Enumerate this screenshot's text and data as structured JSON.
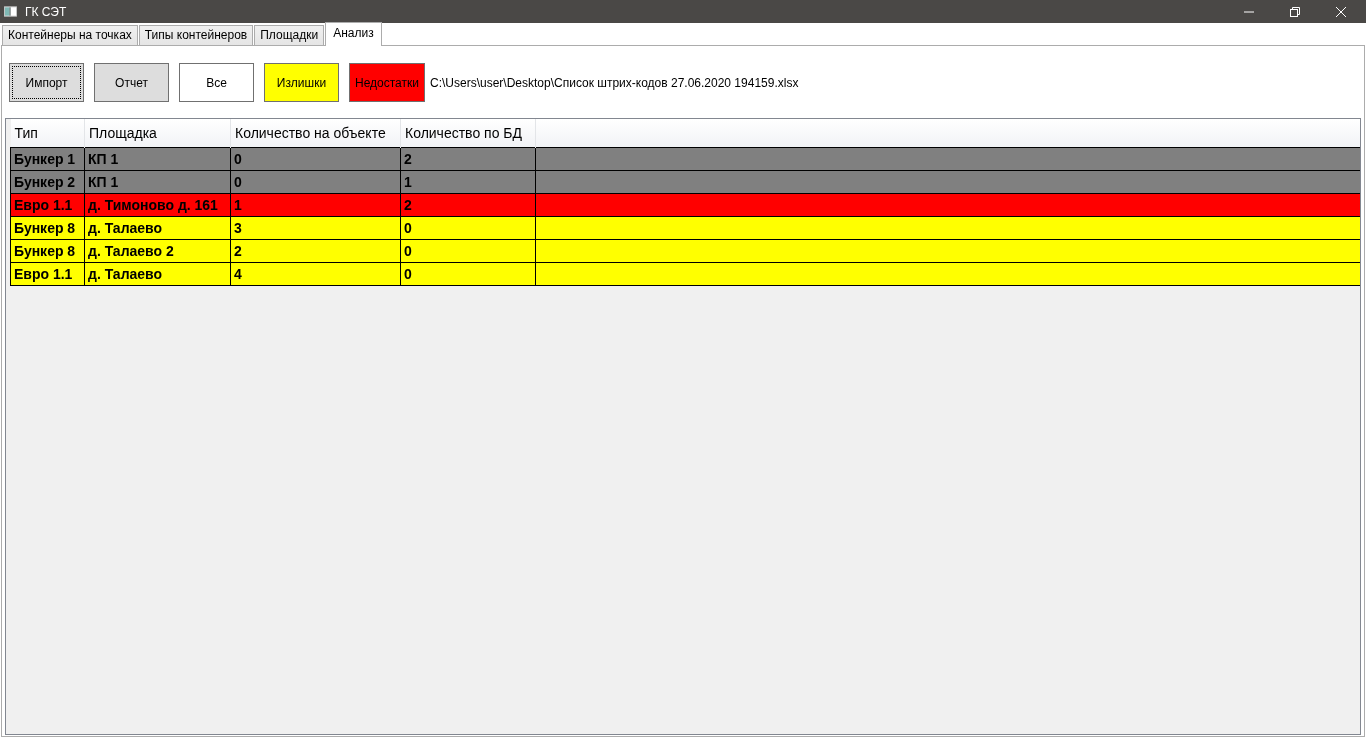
{
  "window": {
    "title": "ГК СЭТ"
  },
  "tabs": [
    {
      "label": "Контейнеры на точках",
      "selected": false
    },
    {
      "label": "Типы контейнеров",
      "selected": false
    },
    {
      "label": "Площадки",
      "selected": false
    },
    {
      "label": "Анализ",
      "selected": true
    }
  ],
  "toolbar": {
    "buttons": [
      {
        "label": "Импорт",
        "color": "#dddddd",
        "focused": true
      },
      {
        "label": "Отчет",
        "color": "#dddddd",
        "focused": false
      },
      {
        "label": "Все",
        "color": "#ffffff",
        "focused": false
      },
      {
        "label": "Излишки",
        "color": "#ffff00",
        "focused": false
      },
      {
        "label": "Недостатки",
        "color": "#ff0000",
        "focused": false
      }
    ],
    "file_path": "C:\\Users\\user\\Desktop\\Список штрих-кодов 27.06.2020 194159.xlsx"
  },
  "table": {
    "columns": [
      "Тип",
      "Площадка",
      "Количество на объекте",
      "Количество по БД"
    ],
    "rows": [
      {
        "cells": [
          "Бункер 1",
          "КП 1",
          "0",
          "2"
        ],
        "color": "#808080"
      },
      {
        "cells": [
          "Бункер 2",
          "КП 1",
          "0",
          "1"
        ],
        "color": "#808080"
      },
      {
        "cells": [
          "Евро 1.1",
          "д. Тимоново д. 161",
          "1",
          "2"
        ],
        "color": "#ff0000"
      },
      {
        "cells": [
          "Бункер 8",
          "д. Талаево",
          "3",
          "0"
        ],
        "color": "#ffff00"
      },
      {
        "cells": [
          "Бункер 8",
          "д. Талаево 2",
          "2",
          "0"
        ],
        "color": "#ffff00"
      },
      {
        "cells": [
          "Евро 1.1",
          "д. Талаево",
          "4",
          "0"
        ],
        "color": "#ffff00"
      }
    ]
  }
}
